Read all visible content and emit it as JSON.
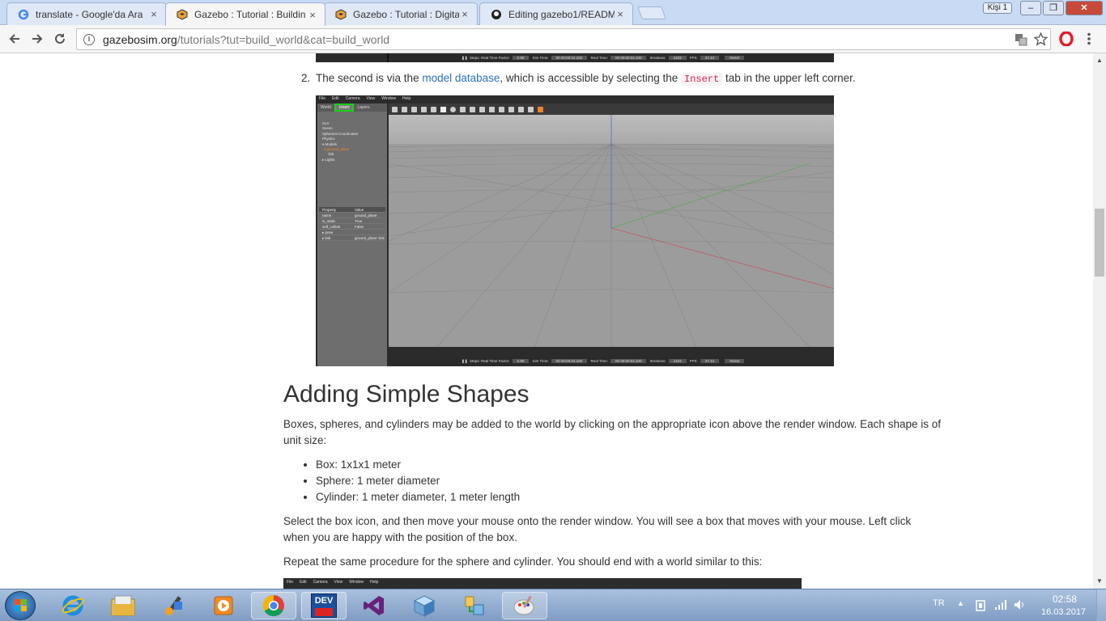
{
  "browser": {
    "tabs": [
      {
        "title": "translate - Google'da Ara",
        "close": "×"
      },
      {
        "title": "Gazebo : Tutorial : Buildin",
        "close": "×"
      },
      {
        "title": "Gazebo : Tutorial : Digita",
        "close": "×"
      },
      {
        "title": "Editing gazebo1/README",
        "close": "×"
      }
    ],
    "active_tab": 1,
    "person_label": "Kişi 1",
    "url_domain": "gazebosim.org",
    "url_path": "/tutorials?tut=build_world&cat=build_world",
    "window_buttons": {
      "minimize": "–",
      "restore": "❐",
      "close": "✕"
    }
  },
  "page": {
    "item2": {
      "number": "2.",
      "before": "The second is via the ",
      "link": "model database",
      "middle": ", which is accessible by selecting the ",
      "code": "Insert",
      "after": " tab in the upper left corner."
    },
    "heading": "Adding Simple Shapes",
    "para1": "Boxes, spheres, and cylinders may be added to the world by clicking on the appropriate icon above the render window. Each shape is of unit size:",
    "list": [
      "Box: 1x1x1 meter",
      "Sphere: 1 meter diameter",
      "Cylinder: 1 meter diameter, 1 meter length"
    ],
    "para2": "Select the box icon, and then move your mouse onto the render window. You will see a box that moves with your mouse. Left click when you are happy with the position of the box.",
    "para3": "Repeat the same procedure for the sphere and cylinder. You should end with a world similar to this:"
  },
  "gazebo": {
    "menu": [
      "File",
      "Edit",
      "Camera",
      "View",
      "Window",
      "Help"
    ],
    "side_tabs": [
      "World",
      "Insert",
      "Layers"
    ],
    "tree": [
      "GUI",
      "Scene",
      "Spherical Coordinates",
      "Physics",
      "▾ Models",
      "  ▾ ground_plane",
      "      link",
      "▸ Lights"
    ],
    "props_header": [
      "Property",
      "Value"
    ],
    "props": [
      [
        "name",
        "ground_plane"
      ],
      [
        "is_static",
        "True"
      ],
      [
        "self_collide",
        "False"
      ],
      [
        "▸ pose",
        ""
      ],
      [
        "▸ link",
        "ground_plane::link"
      ]
    ],
    "status": {
      "steps": "Steps:",
      "rtf_label": "Real Time Factor:",
      "rtf": "0.99",
      "sim_label": "Sim Time:",
      "sim": "00 00:00:04.100",
      "real_label": "Real Time:",
      "real": "00 00:00:04.100",
      "iter_label": "Iterations:",
      "iter": "4103",
      "fps_label": "FPS:",
      "fps": "37.44",
      "reset": "Reset"
    }
  },
  "taskbar": {
    "lang": "TR",
    "time": "02:58",
    "date": "16.03.2017",
    "dev_label": "DEV"
  }
}
